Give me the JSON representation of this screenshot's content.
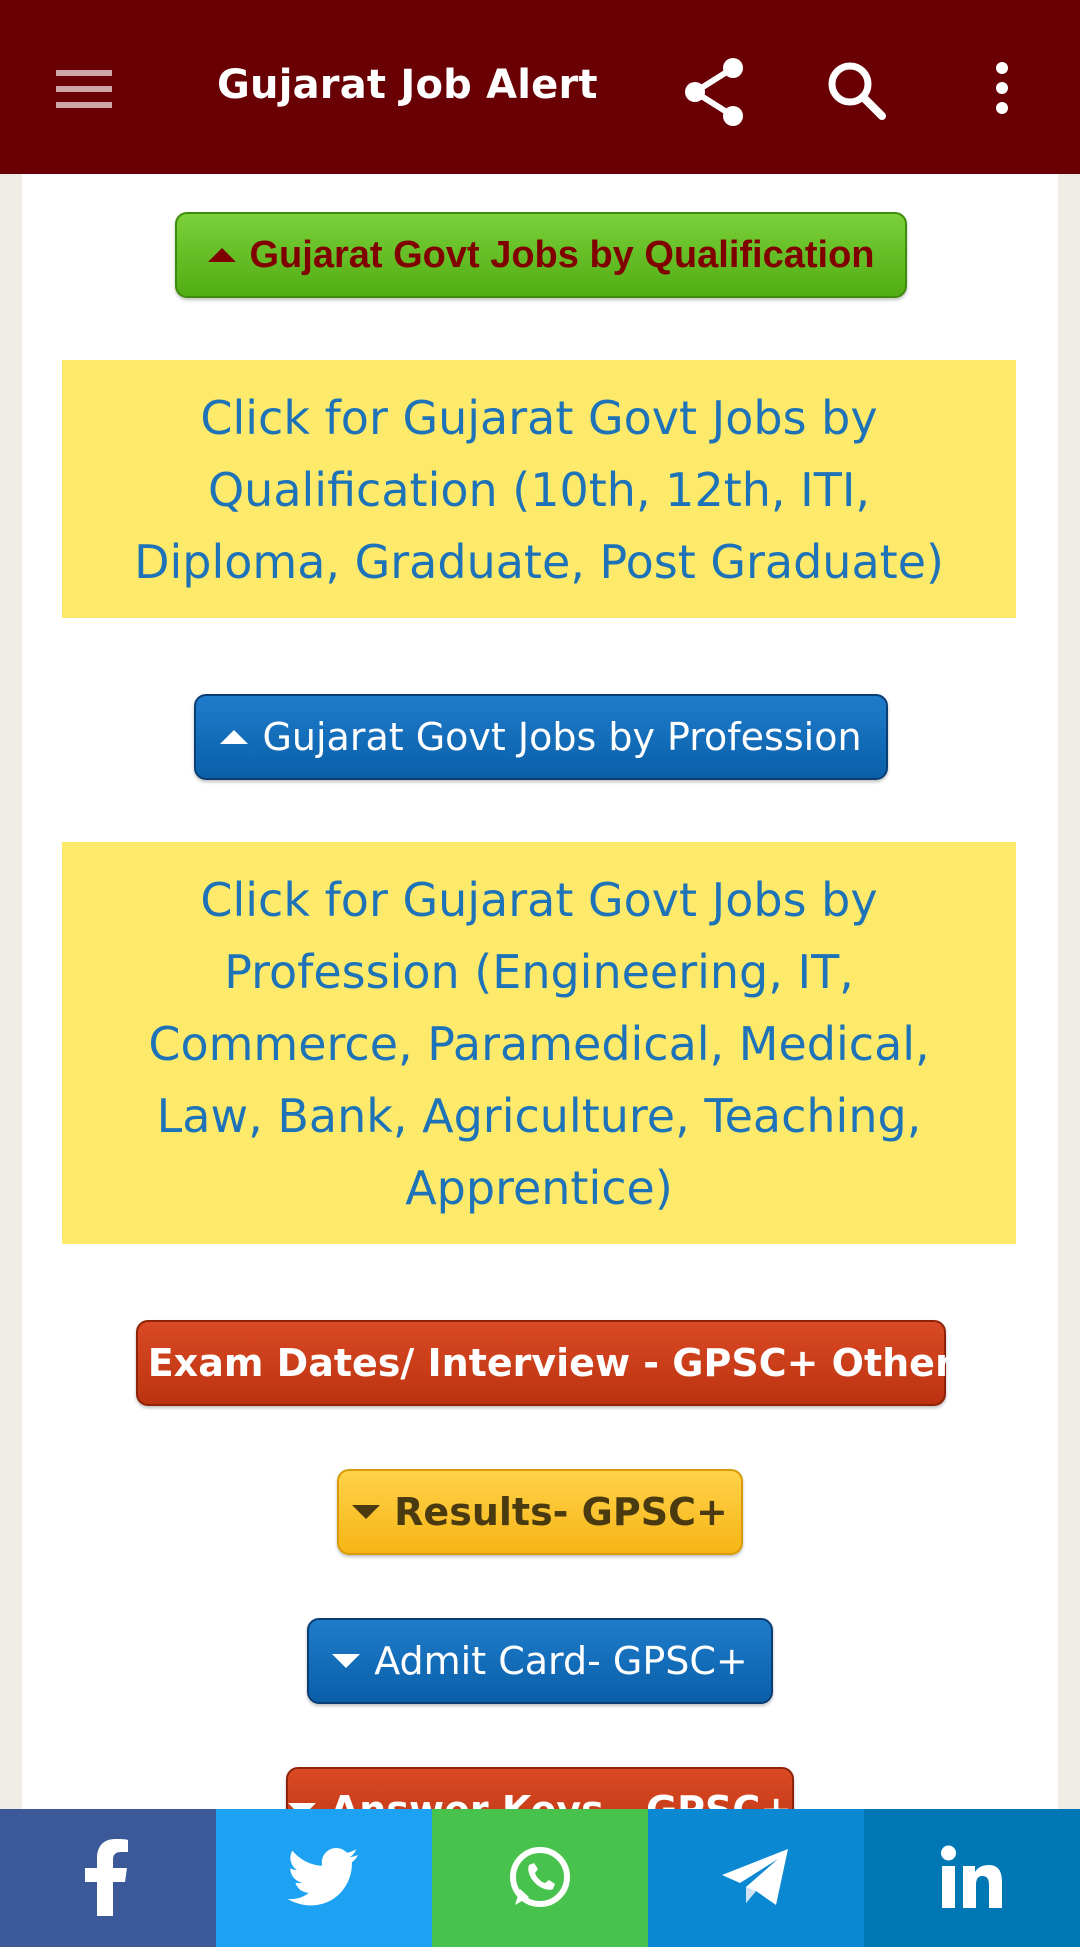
{
  "appbar": {
    "title": "Gujarat Job Alert",
    "icons": [
      "menu-icon",
      "share-icon",
      "search-icon",
      "more-vert-icon"
    ]
  },
  "buttons": {
    "qualification": "Gujarat Govt Jobs by Qualification",
    "profession": "Gujarat Govt Jobs by Profession",
    "exam_dates": "Exam Dates/ Interview - GPSC+ Others",
    "results": "Results- GPSC+",
    "admit_card": "Admit Card- GPSC+",
    "answer_keys": "Answer Keys - GPSC+"
  },
  "notes": {
    "qualification": "Click for Gujarat Govt Jobs by Qualification (10th, 12th, ITI, Diploma, Graduate, Post Graduate)",
    "profession": "Click for Gujarat Govt Jobs by Profession (Engineering, IT, Commerce, Paramedical, Medical, Law, Bank, Agriculture, Teaching, Apprentice)"
  },
  "share_bar": {
    "items": [
      "facebook-icon",
      "twitter-icon",
      "whatsapp-icon",
      "telegram-icon",
      "linkedin-icon"
    ]
  },
  "colors": {
    "appbar": "#690004",
    "green_button": "#5fbd1f",
    "blue_button": "#0f6db8",
    "red_button": "#c93a17",
    "yellow_button": "#fbc12c",
    "note_bg": "#fde96a",
    "note_text": "#1e73b8"
  }
}
